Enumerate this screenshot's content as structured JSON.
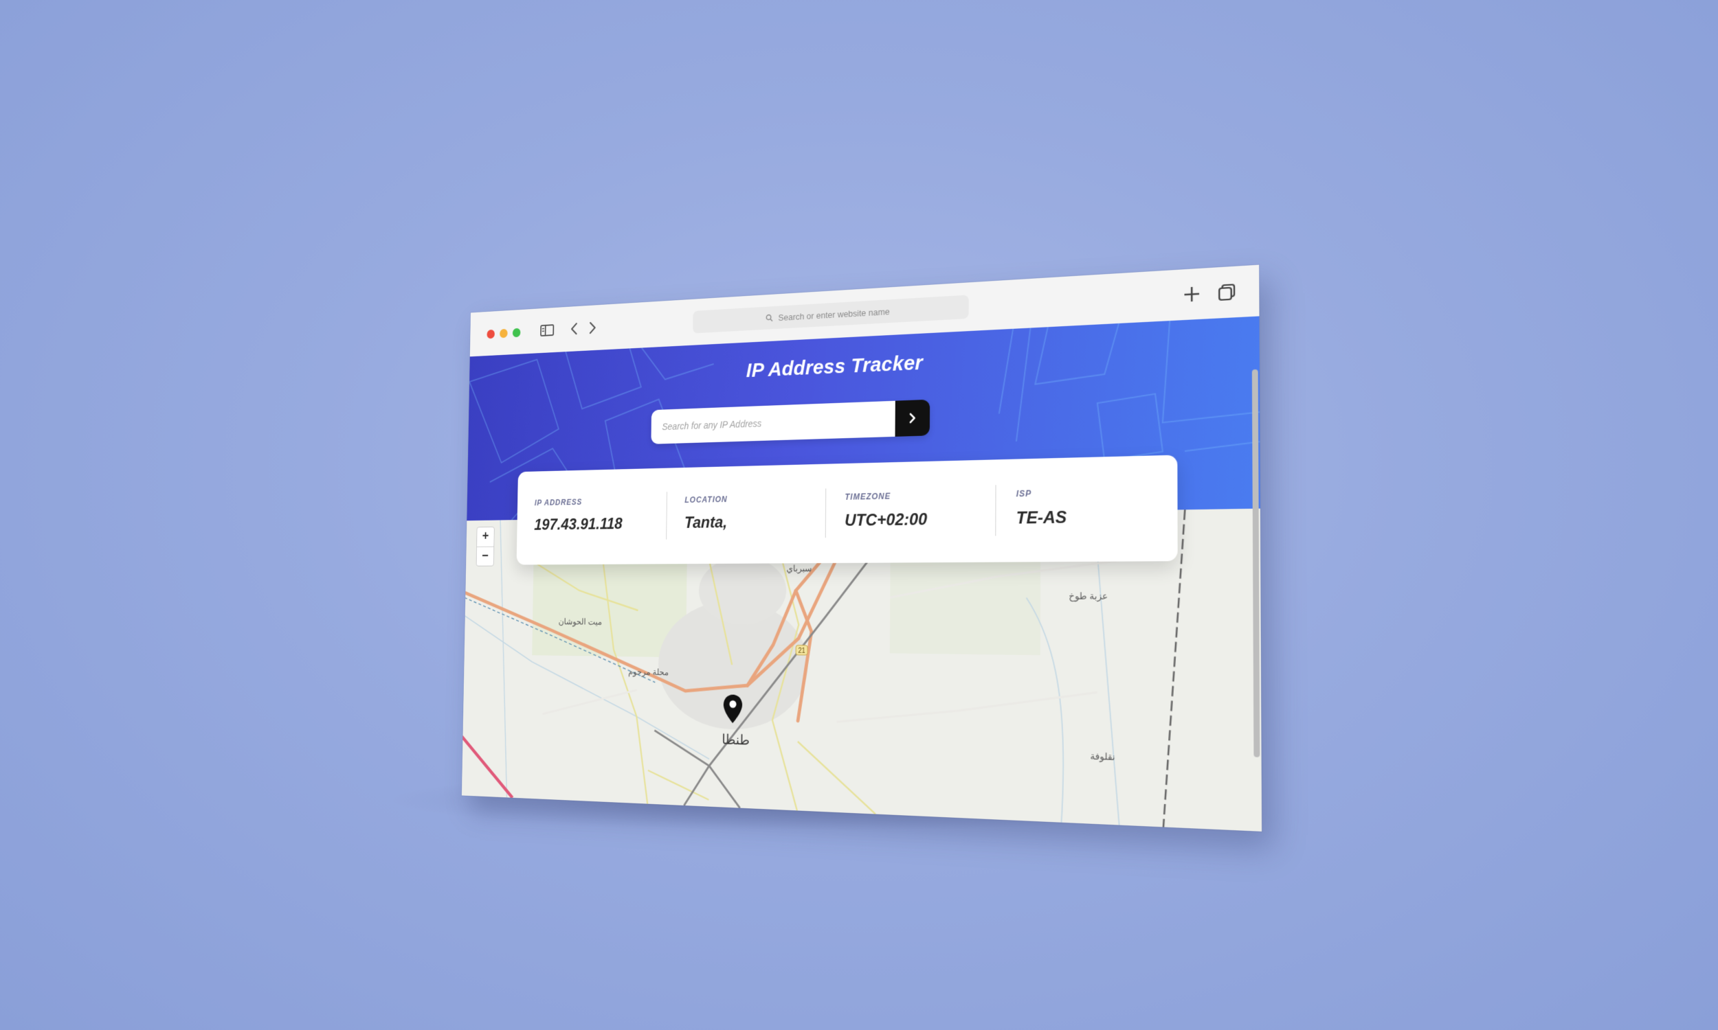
{
  "browser": {
    "address_placeholder": "Search or enter website name",
    "icons": [
      "sidebar-icon",
      "chevron-left-icon",
      "chevron-right-icon",
      "search-icon",
      "plus-icon",
      "tabs-icon"
    ],
    "traffic_light_colors": [
      "#ee4d3f",
      "#f6b23c",
      "#40c24e"
    ]
  },
  "app": {
    "title": "IP Address Tracker",
    "search": {
      "placeholder": "Search for any IP Address",
      "value": ""
    },
    "accent_colors": [
      "#3a3fc2",
      "#4a7cf0"
    ],
    "info": [
      {
        "label": "IP ADDRESS",
        "value": "197.43.91.118"
      },
      {
        "label": "LOCATION",
        "value": "Tanta,"
      },
      {
        "label": "TIMEZONE",
        "value": "UTC+02:00"
      },
      {
        "label": "ISP",
        "value": "TE-AS"
      }
    ]
  },
  "map": {
    "zoom_in": "+",
    "zoom_out": "−",
    "labels": {
      "city": "طنطا",
      "l1": "ميت الحوشان",
      "l2": "محلة مرحوم",
      "l3": "عزبة طوخ",
      "l4": "نقلوفة",
      "l5": "سبرباي",
      "road_number": "21"
    },
    "marker_icon": "location-pin-icon"
  }
}
